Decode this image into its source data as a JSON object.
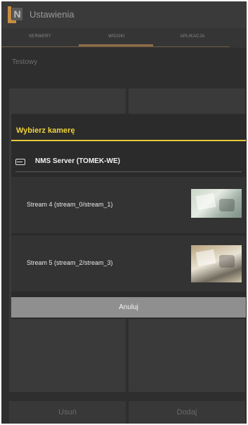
{
  "app": {
    "title": "Ustawienia",
    "logo_letter": "N"
  },
  "tabs": [
    {
      "label": "SERWERY",
      "active": false
    },
    {
      "label": "WIDOKI",
      "active": true
    },
    {
      "label": "APLIKACJA",
      "active": false
    }
  ],
  "view": {
    "name": "Testowy"
  },
  "bottom_buttons": {
    "delete": "Usuń",
    "add": "Dodaj"
  },
  "dialog": {
    "title": "Wybierz kamerę",
    "server": {
      "icon": "server-icon",
      "label": "NMS Server (TOMEK-WE)"
    },
    "streams": [
      {
        "label": "Stream 4 (stream_0/stream_1)",
        "thumbnail": "camera-preview"
      },
      {
        "label": "Stream 5 (stream_2/stream_3)",
        "thumbnail": "camera-preview"
      }
    ],
    "cancel": "Anuluj"
  },
  "colors": {
    "accent_yellow": "#e8c83a",
    "tab_indicator": "#8e6d48",
    "logo_orange": "#c98c3e"
  }
}
